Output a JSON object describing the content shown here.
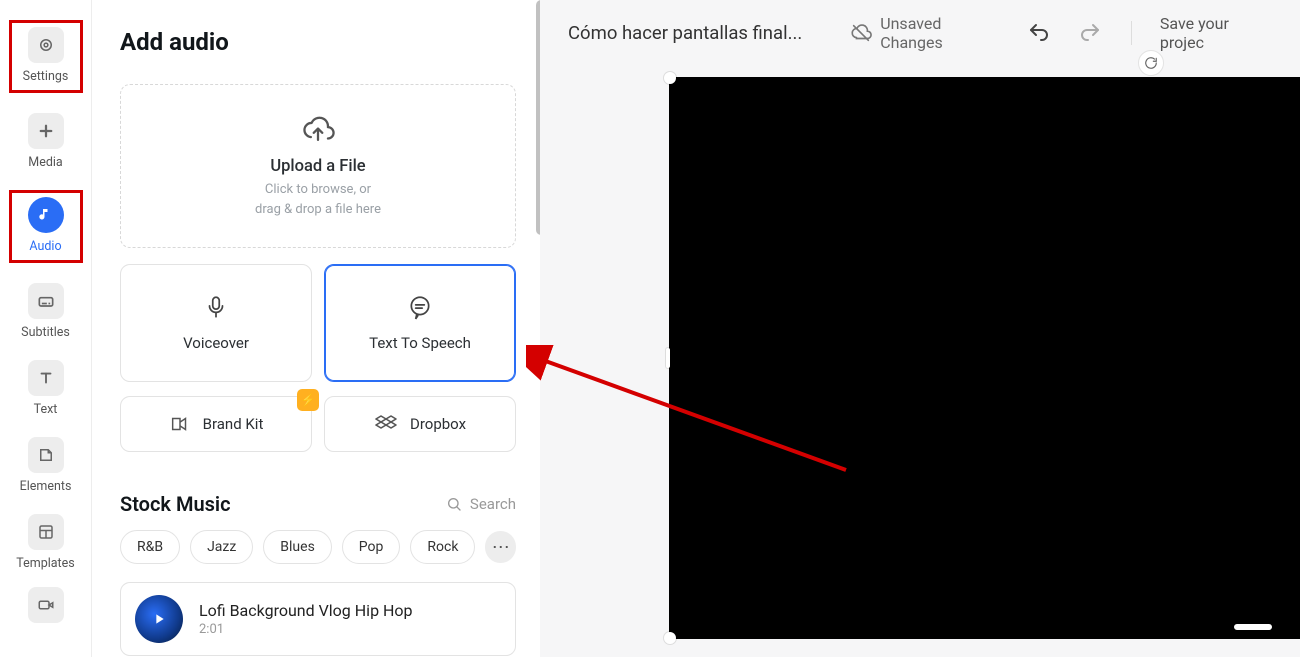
{
  "sidebar": {
    "items": [
      {
        "label": "Settings",
        "boxed": true,
        "active": false
      },
      {
        "label": "Media",
        "boxed": false,
        "active": false
      },
      {
        "label": "Audio",
        "boxed": true,
        "active": true
      },
      {
        "label": "Subtitles",
        "boxed": false,
        "active": false
      },
      {
        "label": "Text",
        "boxed": false,
        "active": false
      },
      {
        "label": "Elements",
        "boxed": false,
        "active": false
      },
      {
        "label": "Templates",
        "boxed": false,
        "active": false
      }
    ]
  },
  "panel": {
    "title": "Add audio",
    "upload": {
      "title": "Upload a File",
      "line1": "Click to browse, or",
      "line2": "drag & drop a file here"
    },
    "tiles": {
      "voiceover": "Voiceover",
      "tts": "Text To Speech",
      "brandkit": "Brand Kit",
      "dropbox": "Dropbox"
    },
    "stock": {
      "heading": "Stock Music",
      "search": "Search",
      "chips": [
        "R&B",
        "Jazz",
        "Blues",
        "Pop",
        "Rock"
      ],
      "track": {
        "name": "Lofi Background Vlog Hip Hop",
        "duration": "2:01"
      }
    }
  },
  "toolbar": {
    "projectTitle": "Cómo hacer pantallas final...",
    "unsaved": "Unsaved Changes",
    "save": "Save your projec"
  }
}
